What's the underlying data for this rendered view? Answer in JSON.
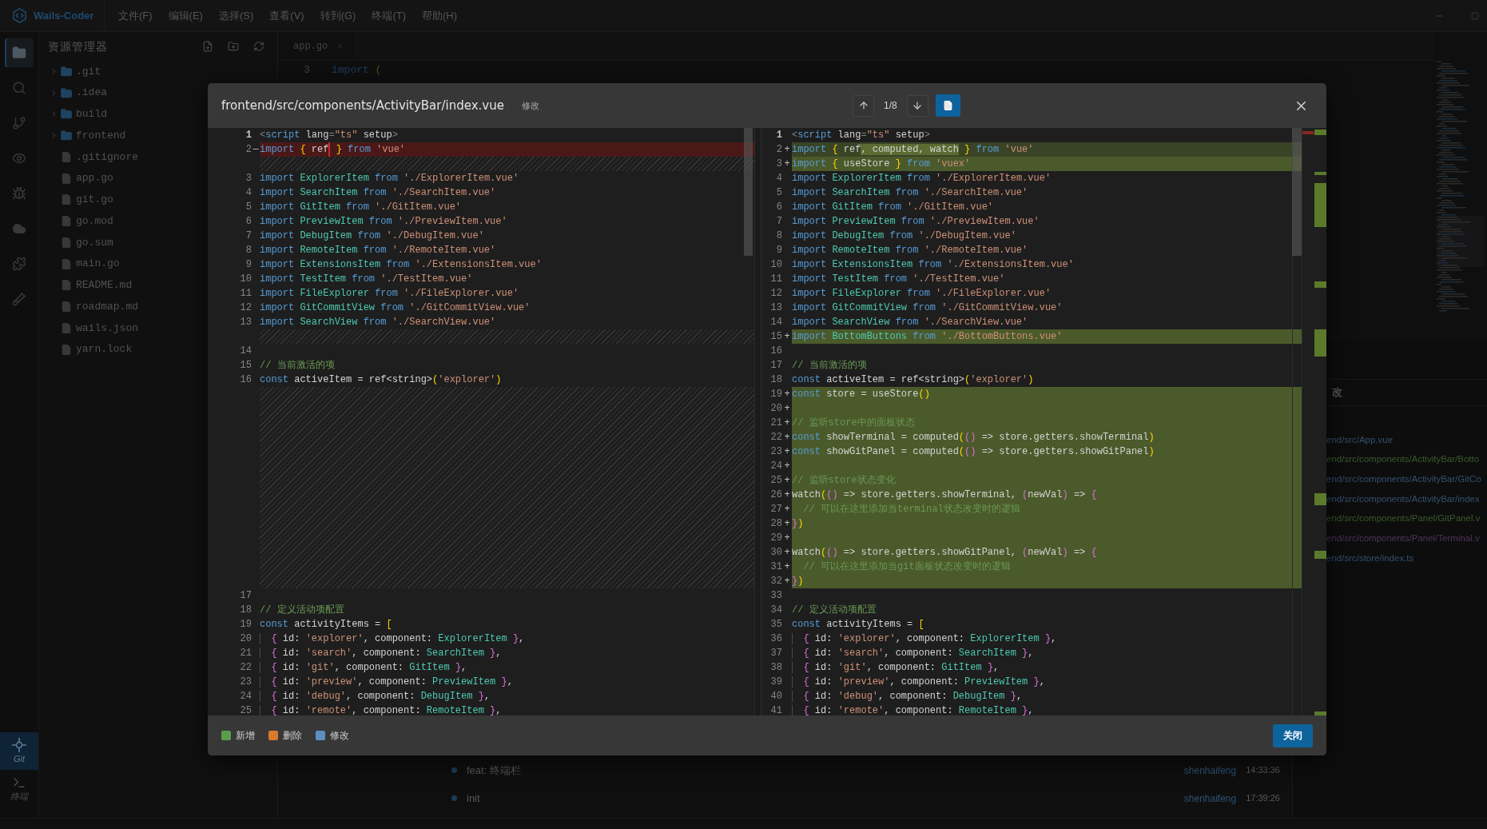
{
  "app": {
    "name": "Wails-Coder",
    "menu": [
      "文件(F)",
      "编辑(E)",
      "选择(S)",
      "查看(V)",
      "转到(G)",
      "终端(T)",
      "帮助(H)"
    ]
  },
  "activity_bar": {
    "items": [
      {
        "selected": true
      },
      {
        "selected": false
      },
      {
        "selected": false
      },
      {
        "selected": false
      },
      {
        "selected": false
      },
      {
        "selected": false
      },
      {
        "selected": false
      },
      {
        "selected": false
      }
    ],
    "bottom_items": [
      {
        "label": "Git",
        "selected": true
      },
      {
        "label": "终端",
        "selected": false
      }
    ]
  },
  "explorer": {
    "title": "资源管理器",
    "items": [
      {
        "kind": "folder",
        "name": ".git",
        "expanded": false
      },
      {
        "kind": "folder",
        "name": ".idea",
        "expanded": false
      },
      {
        "kind": "folder",
        "name": "build",
        "expanded": false
      },
      {
        "kind": "folder",
        "name": "frontend",
        "expanded": false
      },
      {
        "kind": "file",
        "name": ".gitignore"
      },
      {
        "kind": "file",
        "name": "app.go"
      },
      {
        "kind": "file",
        "name": "git.go"
      },
      {
        "kind": "file",
        "name": "go.mod"
      },
      {
        "kind": "file",
        "name": "go.sum"
      },
      {
        "kind": "file",
        "name": "main.go"
      },
      {
        "kind": "file",
        "name": "README.md"
      },
      {
        "kind": "file",
        "name": "roadmap.md"
      },
      {
        "kind": "file",
        "name": "wails.json"
      },
      {
        "kind": "file",
        "name": "yarn.lock"
      }
    ]
  },
  "editor": {
    "tabs": [
      {
        "label": "app.go",
        "selected": true
      }
    ],
    "lines": [
      {
        "number": "3",
        "tokens": [
          {
            "kind": "kw",
            "text": "import"
          },
          {
            "kind": "b1",
            "text": " ("
          }
        ]
      }
    ]
  },
  "changes_panel": {
    "title": "改",
    "files": [
      {
        "path": "end/src/App.vue",
        "color": "#34506e"
      },
      {
        "path": "end/src/components/ActivityBar/Botto",
        "color": "#3a5a2c"
      },
      {
        "path": "end/src/components/ActivityBar/GitCo",
        "color": "#34506e"
      },
      {
        "path": "end/src/components/ActivityBar/index",
        "color": "#34506e"
      },
      {
        "path": "end/src/components/Panel/GitPanel.v",
        "color": "#3a5a2c"
      },
      {
        "path": "end/src/components/Panel/Terminal.v",
        "color": "#4e3458"
      },
      {
        "path": "end/src/store/index.ts",
        "color": "#34506e"
      }
    ]
  },
  "commits": [
    {
      "message": "feat: 终端栏",
      "author": "shenhaifeng",
      "time": "14:33:36"
    },
    {
      "message": "init",
      "author": "shenhaifeng",
      "time": "17:39:26"
    }
  ],
  "diff_dialog": {
    "path": "frontend/src/components/ActivityBar/index.vue",
    "status": "修改",
    "counter": "1/8",
    "view_toggle_on": true,
    "original": {
      "rows": [
        {
          "kind": "normal",
          "number": "1",
          "current": true,
          "tokens": [
            {
              "kind": "tag",
              "text": "<"
            },
            {
              "kind": "kw",
              "text": "script"
            },
            {
              "kind": "id",
              "text": " lang"
            },
            {
              "kind": "tag",
              "text": "="
            },
            {
              "kind": "str",
              "text": "\"ts\""
            },
            {
              "kind": "id",
              "text": " setup"
            },
            {
              "kind": "tag",
              "text": ">"
            }
          ]
        },
        {
          "kind": "removed",
          "number": "2",
          "sign": "—",
          "current": false,
          "tokens": [
            {
              "kind": "kw",
              "text": "import"
            },
            {
              "kind": "b1",
              "text": " {"
            },
            {
              "kind": "id",
              "text": " ref",
              "mark_after": true
            },
            {
              "kind": "b1",
              "text": " }"
            },
            {
              "kind": "kw",
              "text": " from"
            },
            {
              "kind": "str",
              "text": " 'vue'"
            }
          ]
        },
        {
          "kind": "filler"
        },
        {
          "kind": "normal",
          "number": "3",
          "current": false,
          "tokens": [
            {
              "kind": "kw",
              "text": "import"
            },
            {
              "kind": "type",
              "text": " ExplorerItem"
            },
            {
              "kind": "kw",
              "text": " from"
            },
            {
              "kind": "str",
              "text": " './ExplorerItem.vue'"
            }
          ]
        },
        {
          "kind": "normal",
          "number": "4",
          "current": false,
          "tokens": [
            {
              "kind": "kw",
              "text": "import"
            },
            {
              "kind": "type",
              "text": " SearchItem"
            },
            {
              "kind": "kw",
              "text": " from"
            },
            {
              "kind": "str",
              "text": " './SearchItem.vue'"
            }
          ]
        },
        {
          "kind": "normal",
          "number": "5",
          "current": false,
          "tokens": [
            {
              "kind": "kw",
              "text": "import"
            },
            {
              "kind": "type",
              "text": " GitItem"
            },
            {
              "kind": "kw",
              "text": " from"
            },
            {
              "kind": "str",
              "text": " './GitItem.vue'"
            }
          ]
        },
        {
          "kind": "normal",
          "number": "6",
          "current": false,
          "tokens": [
            {
              "kind": "kw",
              "text": "import"
            },
            {
              "kind": "type",
              "text": " PreviewItem"
            },
            {
              "kind": "kw",
              "text": " from"
            },
            {
              "kind": "str",
              "text": " './PreviewItem.vue'"
            }
          ]
        },
        {
          "kind": "normal",
          "number": "7",
          "current": false,
          "tokens": [
            {
              "kind": "kw",
              "text": "import"
            },
            {
              "kind": "type",
              "text": " DebugItem"
            },
            {
              "kind": "kw",
              "text": " from"
            },
            {
              "kind": "str",
              "text": " './DebugItem.vue'"
            }
          ]
        },
        {
          "kind": "normal",
          "number": "8",
          "current": false,
          "tokens": [
            {
              "kind": "kw",
              "text": "import"
            },
            {
              "kind": "type",
              "text": " RemoteItem"
            },
            {
              "kind": "kw",
              "text": " from"
            },
            {
              "kind": "str",
              "text": " './RemoteItem.vue'"
            }
          ]
        },
        {
          "kind": "normal",
          "number": "9",
          "current": false,
          "tokens": [
            {
              "kind": "kw",
              "text": "import"
            },
            {
              "kind": "type",
              "text": " ExtensionsItem"
            },
            {
              "kind": "kw",
              "text": " from"
            },
            {
              "kind": "str",
              "text": " './ExtensionsItem.vue'"
            }
          ]
        },
        {
          "kind": "normal",
          "number": "10",
          "current": false,
          "tokens": [
            {
              "kind": "kw",
              "text": "import"
            },
            {
              "kind": "type",
              "text": " TestItem"
            },
            {
              "kind": "kw",
              "text": " from"
            },
            {
              "kind": "str",
              "text": " './TestItem.vue'"
            }
          ]
        },
        {
          "kind": "normal",
          "number": "11",
          "current": false,
          "tokens": [
            {
              "kind": "kw",
              "text": "import"
            },
            {
              "kind": "type",
              "text": " FileExplorer"
            },
            {
              "kind": "kw",
              "text": " from"
            },
            {
              "kind": "str",
              "text": " './FileExplorer.vue'"
            }
          ]
        },
        {
          "kind": "normal",
          "number": "12",
          "current": false,
          "tokens": [
            {
              "kind": "kw",
              "text": "import"
            },
            {
              "kind": "type",
              "text": " GitCommitView"
            },
            {
              "kind": "kw",
              "text": " from"
            },
            {
              "kind": "str",
              "text": " './GitCommitView.vue'"
            }
          ]
        },
        {
          "kind": "normal",
          "number": "13",
          "current": false,
          "tokens": [
            {
              "kind": "kw",
              "text": "import"
            },
            {
              "kind": "type",
              "text": " SearchView"
            },
            {
              "kind": "kw",
              "text": " from"
            },
            {
              "kind": "str",
              "text": " './SearchView.vue'"
            }
          ]
        },
        {
          "kind": "filler"
        },
        {
          "kind": "normal",
          "number": "14",
          "current": false
        },
        {
          "kind": "normal",
          "number": "15",
          "current": false,
          "tokens": [
            {
              "kind": "com",
              "text": "// 当前激活的项"
            }
          ]
        },
        {
          "kind": "normal",
          "number": "16",
          "current": false,
          "tokens": [
            {
              "kind": "kw",
              "text": "const"
            },
            {
              "kind": "id",
              "text": " activeItem = ref<string>"
            },
            {
              "kind": "b1",
              "text": "("
            },
            {
              "kind": "str",
              "text": "'explorer'"
            },
            {
              "kind": "b1",
              "text": ")"
            }
          ]
        },
        {
          "kind": "filler"
        },
        {
          "kind": "filler"
        },
        {
          "kind": "filler"
        },
        {
          "kind": "filler"
        },
        {
          "kind": "filler"
        },
        {
          "kind": "filler"
        },
        {
          "kind": "filler"
        },
        {
          "kind": "filler"
        },
        {
          "kind": "filler"
        },
        {
          "kind": "filler"
        },
        {
          "kind": "filler"
        },
        {
          "kind": "filler"
        },
        {
          "kind": "filler"
        },
        {
          "kind": "filler"
        },
        {
          "kind": "normal",
          "number": "17",
          "current": false
        },
        {
          "kind": "normal",
          "number": "18",
          "current": false,
          "tokens": [
            {
              "kind": "com",
              "text": "// 定义活动项配置"
            }
          ]
        },
        {
          "kind": "normal",
          "number": "19",
          "current": false,
          "tokens": [
            {
              "kind": "kw",
              "text": "const"
            },
            {
              "kind": "id",
              "text": " activityItems = "
            },
            {
              "kind": "b1",
              "text": "["
            }
          ]
        },
        {
          "kind": "normal",
          "number": "20",
          "current": false,
          "indent_guide": true,
          "tokens": [
            {
              "kind": "b2",
              "text": "  {"
            },
            {
              "kind": "id",
              "text": " id: "
            },
            {
              "kind": "str",
              "text": "'explorer'"
            },
            {
              "kind": "id",
              "text": ", component: "
            },
            {
              "kind": "type",
              "text": "ExplorerItem"
            },
            {
              "kind": "b2",
              "text": " }"
            },
            {
              "kind": "id",
              "text": ","
            }
          ]
        },
        {
          "kind": "normal",
          "number": "21",
          "current": false,
          "indent_guide": true,
          "tokens": [
            {
              "kind": "b2",
              "text": "  {"
            },
            {
              "kind": "id",
              "text": " id: "
            },
            {
              "kind": "str",
              "text": "'search'"
            },
            {
              "kind": "id",
              "text": ", component: "
            },
            {
              "kind": "type",
              "text": "SearchItem"
            },
            {
              "kind": "b2",
              "text": " }"
            },
            {
              "kind": "id",
              "text": ","
            }
          ]
        },
        {
          "kind": "normal",
          "number": "22",
          "current": false,
          "indent_guide": true,
          "tokens": [
            {
              "kind": "b2",
              "text": "  {"
            },
            {
              "kind": "id",
              "text": " id: "
            },
            {
              "kind": "str",
              "text": "'git'"
            },
            {
              "kind": "id",
              "text": ", component: "
            },
            {
              "kind": "type",
              "text": "GitItem"
            },
            {
              "kind": "b2",
              "text": " }"
            },
            {
              "kind": "id",
              "text": ","
            }
          ]
        },
        {
          "kind": "normal",
          "number": "23",
          "current": false,
          "indent_guide": true,
          "tokens": [
            {
              "kind": "b2",
              "text": "  {"
            },
            {
              "kind": "id",
              "text": " id: "
            },
            {
              "kind": "str",
              "text": "'preview'"
            },
            {
              "kind": "id",
              "text": ", component: "
            },
            {
              "kind": "type",
              "text": "PreviewItem"
            },
            {
              "kind": "b2",
              "text": " }"
            },
            {
              "kind": "id",
              "text": ","
            }
          ]
        },
        {
          "kind": "normal",
          "number": "24",
          "current": false,
          "indent_guide": true,
          "tokens": [
            {
              "kind": "b2",
              "text": "  {"
            },
            {
              "kind": "id",
              "text": " id: "
            },
            {
              "kind": "str",
              "text": "'debug'"
            },
            {
              "kind": "id",
              "text": ", component: "
            },
            {
              "kind": "type",
              "text": "DebugItem"
            },
            {
              "kind": "b2",
              "text": " }"
            },
            {
              "kind": "id",
              "text": ","
            }
          ]
        },
        {
          "kind": "normal",
          "number": "25",
          "current": false,
          "indent_guide": true,
          "tokens": [
            {
              "kind": "b2",
              "text": "  {"
            },
            {
              "kind": "id",
              "text": " id: "
            },
            {
              "kind": "str",
              "text": "'remote'"
            },
            {
              "kind": "id",
              "text": ", component: "
            },
            {
              "kind": "type",
              "text": "RemoteItem"
            },
            {
              "kind": "b2",
              "text": " }"
            },
            {
              "kind": "id",
              "text": ","
            }
          ]
        }
      ]
    },
    "modified": {
      "rows": [
        {
          "kind": "normal",
          "number": "1",
          "current": true,
          "tokens": [
            {
              "kind": "tag",
              "text": "<"
            },
            {
              "kind": "kw",
              "text": "script"
            },
            {
              "kind": "id",
              "text": " lang"
            },
            {
              "kind": "tag",
              "text": "="
            },
            {
              "kind": "str",
              "text": "\"ts\""
            },
            {
              "kind": "id",
              "text": " setup"
            },
            {
              "kind": "tag",
              "text": ">"
            }
          ]
        },
        {
          "kind": "changed",
          "number": "2",
          "sign": "+",
          "current": false,
          "tokens": [
            {
              "kind": "kw",
              "text": "import"
            },
            {
              "kind": "b1",
              "text": " {"
            },
            {
              "kind": "id",
              "text": " ref"
            },
            {
              "kind": "id",
              "text": ", computed, watch",
              "inserted": true
            },
            {
              "kind": "b1",
              "text": " }"
            },
            {
              "kind": "kw",
              "text": " from"
            },
            {
              "kind": "str",
              "text": " 'vue'"
            }
          ]
        },
        {
          "kind": "added",
          "number": "3",
          "sign": "+",
          "current": false,
          "tokens": [
            {
              "kind": "kw",
              "text": "import"
            },
            {
              "kind": "b1",
              "text": " {"
            },
            {
              "kind": "id",
              "text": " useStore"
            },
            {
              "kind": "b1",
              "text": " }"
            },
            {
              "kind": "kw",
              "text": " from"
            },
            {
              "kind": "str",
              "text": " 'vuex'"
            }
          ]
        },
        {
          "kind": "normal",
          "number": "4",
          "current": false,
          "tokens": [
            {
              "kind": "kw",
              "text": "import"
            },
            {
              "kind": "type",
              "text": " ExplorerItem"
            },
            {
              "kind": "kw",
              "text": " from"
            },
            {
              "kind": "str",
              "text": " './ExplorerItem.vue'"
            }
          ]
        },
        {
          "kind": "normal",
          "number": "5",
          "current": false,
          "tokens": [
            {
              "kind": "kw",
              "text": "import"
            },
            {
              "kind": "type",
              "text": " SearchItem"
            },
            {
              "kind": "kw",
              "text": " from"
            },
            {
              "kind": "str",
              "text": " './SearchItem.vue'"
            }
          ]
        },
        {
          "kind": "normal",
          "number": "6",
          "current": false,
          "tokens": [
            {
              "kind": "kw",
              "text": "import"
            },
            {
              "kind": "type",
              "text": " GitItem"
            },
            {
              "kind": "kw",
              "text": " from"
            },
            {
              "kind": "str",
              "text": " './GitItem.vue'"
            }
          ]
        },
        {
          "kind": "normal",
          "number": "7",
          "current": false,
          "tokens": [
            {
              "kind": "kw",
              "text": "import"
            },
            {
              "kind": "type",
              "text": " PreviewItem"
            },
            {
              "kind": "kw",
              "text": " from"
            },
            {
              "kind": "str",
              "text": " './PreviewItem.vue'"
            }
          ]
        },
        {
          "kind": "normal",
          "number": "8",
          "current": false,
          "tokens": [
            {
              "kind": "kw",
              "text": "import"
            },
            {
              "kind": "type",
              "text": " DebugItem"
            },
            {
              "kind": "kw",
              "text": " from"
            },
            {
              "kind": "str",
              "text": " './DebugItem.vue'"
            }
          ]
        },
        {
          "kind": "normal",
          "number": "9",
          "current": false,
          "tokens": [
            {
              "kind": "kw",
              "text": "import"
            },
            {
              "kind": "type",
              "text": " RemoteItem"
            },
            {
              "kind": "kw",
              "text": " from"
            },
            {
              "kind": "str",
              "text": " './RemoteItem.vue'"
            }
          ]
        },
        {
          "kind": "normal",
          "number": "10",
          "current": false,
          "tokens": [
            {
              "kind": "kw",
              "text": "import"
            },
            {
              "kind": "type",
              "text": " ExtensionsItem"
            },
            {
              "kind": "kw",
              "text": " from"
            },
            {
              "kind": "str",
              "text": " './ExtensionsItem.vue'"
            }
          ]
        },
        {
          "kind": "normal",
          "number": "11",
          "current": false,
          "tokens": [
            {
              "kind": "kw",
              "text": "import"
            },
            {
              "kind": "type",
              "text": " TestItem"
            },
            {
              "kind": "kw",
              "text": " from"
            },
            {
              "kind": "str",
              "text": " './TestItem.vue'"
            }
          ]
        },
        {
          "kind": "normal",
          "number": "12",
          "current": false,
          "tokens": [
            {
              "kind": "kw",
              "text": "import"
            },
            {
              "kind": "type",
              "text": " FileExplorer"
            },
            {
              "kind": "kw",
              "text": " from"
            },
            {
              "kind": "str",
              "text": " './FileExplorer.vue'"
            }
          ]
        },
        {
          "kind": "normal",
          "number": "13",
          "current": false,
          "tokens": [
            {
              "kind": "kw",
              "text": "import"
            },
            {
              "kind": "type",
              "text": " GitCommitView"
            },
            {
              "kind": "kw",
              "text": " from"
            },
            {
              "kind": "str",
              "text": " './GitCommitView.vue'"
            }
          ]
        },
        {
          "kind": "normal",
          "number": "14",
          "current": false,
          "tokens": [
            {
              "kind": "kw",
              "text": "import"
            },
            {
              "kind": "type",
              "text": " SearchView"
            },
            {
              "kind": "kw",
              "text": " from"
            },
            {
              "kind": "str",
              "text": " './SearchView.vue'"
            }
          ]
        },
        {
          "kind": "added",
          "number": "15",
          "sign": "+",
          "current": false,
          "tokens": [
            {
              "kind": "kw",
              "text": "import"
            },
            {
              "kind": "type",
              "text": " BottomButtons"
            },
            {
              "kind": "kw",
              "text": " from"
            },
            {
              "kind": "str",
              "text": " './BottomButtons.vue'"
            }
          ]
        },
        {
          "kind": "normal",
          "number": "16",
          "current": false
        },
        {
          "kind": "normal",
          "number": "17",
          "current": false,
          "tokens": [
            {
              "kind": "com",
              "text": "// 当前激活的项"
            }
          ]
        },
        {
          "kind": "normal",
          "number": "18",
          "current": false,
          "tokens": [
            {
              "kind": "kw",
              "text": "const"
            },
            {
              "kind": "id",
              "text": " activeItem = ref<string>"
            },
            {
              "kind": "b1",
              "text": "("
            },
            {
              "kind": "str",
              "text": "'explorer'"
            },
            {
              "kind": "b1",
              "text": ")"
            }
          ]
        },
        {
          "kind": "added",
          "number": "19",
          "sign": "+",
          "current": false,
          "tokens": [
            {
              "kind": "kw",
              "text": "const"
            },
            {
              "kind": "id",
              "text": " store = useStore"
            },
            {
              "kind": "b1",
              "text": "()"
            }
          ]
        },
        {
          "kind": "added",
          "number": "20",
          "sign": "+",
          "current": false
        },
        {
          "kind": "added",
          "number": "21",
          "sign": "+",
          "current": false,
          "tokens": [
            {
              "kind": "com",
              "text": "// 监听store中的面板状态"
            }
          ]
        },
        {
          "kind": "added",
          "number": "22",
          "sign": "+",
          "current": false,
          "tokens": [
            {
              "kind": "kw",
              "text": "const"
            },
            {
              "kind": "id",
              "text": " showTerminal = computed"
            },
            {
              "kind": "b1",
              "text": "("
            },
            {
              "kind": "b2",
              "text": "()"
            },
            {
              "kind": "id",
              "text": " => store.getters.showTerminal"
            },
            {
              "kind": "b1",
              "text": ")"
            }
          ]
        },
        {
          "kind": "added",
          "number": "23",
          "sign": "+",
          "current": false,
          "tokens": [
            {
              "kind": "kw",
              "text": "const"
            },
            {
              "kind": "id",
              "text": " showGitPanel = computed"
            },
            {
              "kind": "b1",
              "text": "("
            },
            {
              "kind": "b2",
              "text": "()"
            },
            {
              "kind": "id",
              "text": " => store.getters.showGitPanel"
            },
            {
              "kind": "b1",
              "text": ")"
            }
          ]
        },
        {
          "kind": "added",
          "number": "24",
          "sign": "+",
          "current": false
        },
        {
          "kind": "added",
          "number": "25",
          "sign": "+",
          "current": false,
          "tokens": [
            {
              "kind": "com",
              "text": "// 监听store状态变化"
            }
          ]
        },
        {
          "kind": "added",
          "number": "26",
          "sign": "+",
          "current": false,
          "tokens": [
            {
              "kind": "id",
              "text": "watch"
            },
            {
              "kind": "b1",
              "text": "("
            },
            {
              "kind": "b2",
              "text": "()"
            },
            {
              "kind": "id",
              "text": " => store.getters.showTerminal, "
            },
            {
              "kind": "b2",
              "text": "("
            },
            {
              "kind": "id",
              "text": "newVal"
            },
            {
              "kind": "b2",
              "text": ")"
            },
            {
              "kind": "id",
              "text": " => "
            },
            {
              "kind": "b2",
              "text": "{"
            }
          ]
        },
        {
          "kind": "added",
          "number": "27",
          "sign": "+",
          "current": false,
          "tokens": [
            {
              "kind": "com",
              "text": "  // 可以在这里添加当terminal状态改变时的逻辑"
            }
          ]
        },
        {
          "kind": "added",
          "number": "28",
          "sign": "+",
          "current": false,
          "tokens": [
            {
              "kind": "b2",
              "text": "}"
            },
            {
              "kind": "b1",
              "text": ")"
            }
          ]
        },
        {
          "kind": "added",
          "number": "29",
          "sign": "+",
          "current": false
        },
        {
          "kind": "added",
          "number": "30",
          "sign": "+",
          "current": false,
          "tokens": [
            {
              "kind": "id",
              "text": "watch"
            },
            {
              "kind": "b1",
              "text": "("
            },
            {
              "kind": "b2",
              "text": "()"
            },
            {
              "kind": "id",
              "text": " => store.getters.showGitPanel, "
            },
            {
              "kind": "b2",
              "text": "("
            },
            {
              "kind": "id",
              "text": "newVal"
            },
            {
              "kind": "b2",
              "text": ")"
            },
            {
              "kind": "id",
              "text": " => "
            },
            {
              "kind": "b2",
              "text": "{"
            }
          ]
        },
        {
          "kind": "added",
          "number": "31",
          "sign": "+",
          "current": false,
          "tokens": [
            {
              "kind": "com",
              "text": "  // 可以在这里添加当git面板状态改变时的逻辑"
            }
          ]
        },
        {
          "kind": "added",
          "number": "32",
          "sign": "+",
          "current": false,
          "tokens": [
            {
              "kind": "b2",
              "text": "}"
            },
            {
              "kind": "b1",
              "text": ")"
            }
          ]
        },
        {
          "kind": "normal",
          "number": "33",
          "current": false
        },
        {
          "kind": "normal",
          "number": "34",
          "current": false,
          "tokens": [
            {
              "kind": "com",
              "text": "// 定义活动项配置"
            }
          ]
        },
        {
          "kind": "normal",
          "number": "35",
          "current": false,
          "tokens": [
            {
              "kind": "kw",
              "text": "const"
            },
            {
              "kind": "id",
              "text": " activityItems = "
            },
            {
              "kind": "b1",
              "text": "["
            }
          ]
        },
        {
          "kind": "normal",
          "number": "36",
          "current": false,
          "indent_guide": true,
          "tokens": [
            {
              "kind": "b2",
              "text": "  {"
            },
            {
              "kind": "id",
              "text": " id: "
            },
            {
              "kind": "str",
              "text": "'explorer'"
            },
            {
              "kind": "id",
              "text": ", component: "
            },
            {
              "kind": "type",
              "text": "ExplorerItem"
            },
            {
              "kind": "b2",
              "text": " }"
            },
            {
              "kind": "id",
              "text": ","
            }
          ]
        },
        {
          "kind": "normal",
          "number": "37",
          "current": false,
          "indent_guide": true,
          "tokens": [
            {
              "kind": "b2",
              "text": "  {"
            },
            {
              "kind": "id",
              "text": " id: "
            },
            {
              "kind": "str",
              "text": "'search'"
            },
            {
              "kind": "id",
              "text": ", component: "
            },
            {
              "kind": "type",
              "text": "SearchItem"
            },
            {
              "kind": "b2",
              "text": " }"
            },
            {
              "kind": "id",
              "text": ","
            }
          ]
        },
        {
          "kind": "normal",
          "number": "38",
          "current": false,
          "indent_guide": true,
          "tokens": [
            {
              "kind": "b2",
              "text": "  {"
            },
            {
              "kind": "id",
              "text": " id: "
            },
            {
              "kind": "str",
              "text": "'git'"
            },
            {
              "kind": "id",
              "text": ", component: "
            },
            {
              "kind": "type",
              "text": "GitItem"
            },
            {
              "kind": "b2",
              "text": " }"
            },
            {
              "kind": "id",
              "text": ","
            }
          ]
        },
        {
          "kind": "normal",
          "number": "39",
          "current": false,
          "indent_guide": true,
          "tokens": [
            {
              "kind": "b2",
              "text": "  {"
            },
            {
              "kind": "id",
              "text": " id: "
            },
            {
              "kind": "str",
              "text": "'preview'"
            },
            {
              "kind": "id",
              "text": ", component: "
            },
            {
              "kind": "type",
              "text": "PreviewItem"
            },
            {
              "kind": "b2",
              "text": " }"
            },
            {
              "kind": "id",
              "text": ","
            }
          ]
        },
        {
          "kind": "normal",
          "number": "40",
          "current": false,
          "indent_guide": true,
          "tokens": [
            {
              "kind": "b2",
              "text": "  {"
            },
            {
              "kind": "id",
              "text": " id: "
            },
            {
              "kind": "str",
              "text": "'debug'"
            },
            {
              "kind": "id",
              "text": ", component: "
            },
            {
              "kind": "type",
              "text": "DebugItem"
            },
            {
              "kind": "b2",
              "text": " }"
            },
            {
              "kind": "id",
              "text": ","
            }
          ]
        },
        {
          "kind": "normal",
          "number": "41",
          "current": false,
          "indent_guide": true,
          "tokens": [
            {
              "kind": "b2",
              "text": "  {"
            },
            {
              "kind": "id",
              "text": " id: "
            },
            {
              "kind": "str",
              "text": "'remote'"
            },
            {
              "kind": "id",
              "text": ", component: "
            },
            {
              "kind": "type",
              "text": "RemoteItem"
            },
            {
              "kind": "b2",
              "text": " }"
            },
            {
              "kind": "id",
              "text": ","
            }
          ]
        }
      ]
    },
    "legend": [
      {
        "label": "新增",
        "color": "#5a9e4a"
      },
      {
        "label": "删除",
        "color": "#d9792c"
      },
      {
        "label": "修改",
        "color": "#5d8fc1"
      }
    ],
    "close_label": "关闭"
  }
}
